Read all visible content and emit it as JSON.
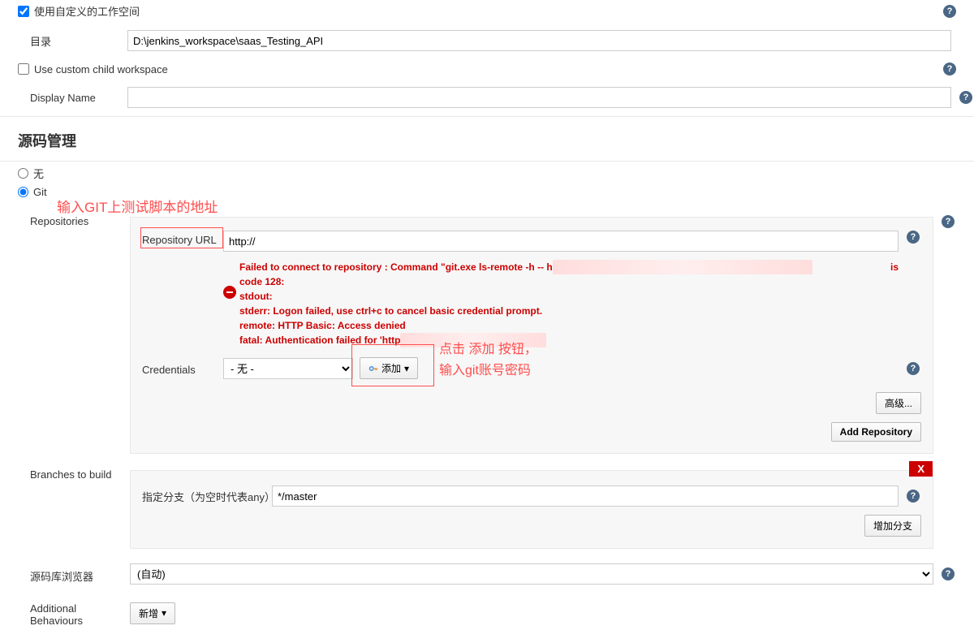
{
  "workspace": {
    "use_custom_label": "使用自定义的工作空间",
    "dir_label": "目录",
    "dir_value": "D:\\jenkins_workspace\\saas_Testing_API",
    "use_child_label": "Use custom child workspace",
    "display_name_label": "Display Name",
    "display_name_value": ""
  },
  "scm": {
    "title": "源码管理",
    "none_label": "无",
    "git_label": "Git",
    "repositories_label": "Repositories",
    "repo_url_label": "Repository URL",
    "repo_url_value": "http://",
    "error_lines": [
      "Failed to connect to repository : Command \"git.exe ls-remote -h -- h",
      "code 128:",
      "stdout:",
      "stderr: Logon failed, use ctrl+c to cancel basic credential prompt.",
      "remote: HTTP Basic: Access denied",
      "fatal: Authentication failed for 'http"
    ],
    "error_suffix": "is",
    "credentials_label": "Credentials",
    "credentials_value": "- 无 -",
    "add_label": "添加",
    "advanced_label": "高级...",
    "add_repo_label": "Add Repository",
    "branches_label": "Branches to build",
    "branch_spec_label": "指定分支（为空时代表any）",
    "branch_spec_value": "*/master",
    "add_branch_label": "增加分支",
    "delete_label": "X",
    "repo_browser_label": "源码库浏览器",
    "repo_browser_value": "(自动)",
    "additional_label": "Additional Behaviours",
    "additional_add_label": "新增"
  },
  "annotations": {
    "a1": "输入GIT上测试脚本的地址",
    "a2_line1": "点击 添加 按钮，",
    "a2_line2": "输入git账号密码"
  }
}
